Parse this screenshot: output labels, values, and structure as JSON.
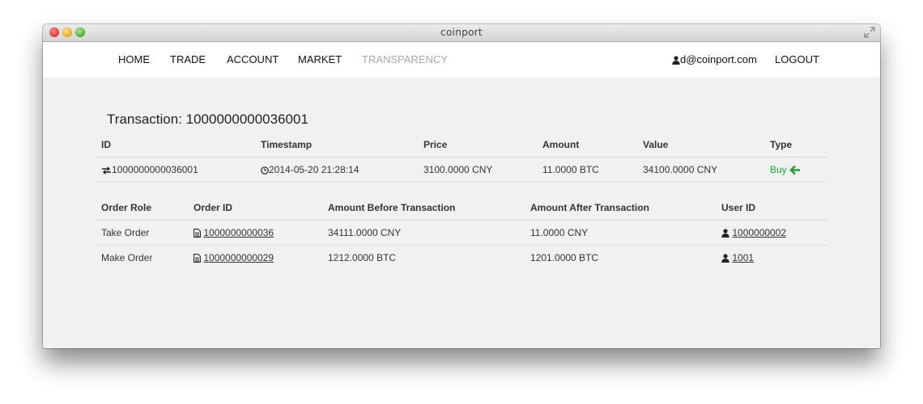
{
  "window": {
    "title": "coinport"
  },
  "nav": {
    "home": "HOME",
    "trade": "TRADE",
    "account": "ACCOUNT",
    "market": "MARKET",
    "transparency": "TRANSPARENCY",
    "user_email": "d@coinport.com",
    "logout": "LOGOUT"
  },
  "page": {
    "title": "Transaction: 1000000000036001"
  },
  "transaction": {
    "headers": {
      "id": "ID",
      "timestamp": "Timestamp",
      "price": "Price",
      "amount": "Amount",
      "value": "Value",
      "type": "Type"
    },
    "row": {
      "id": "1000000000036001",
      "timestamp": "2014-05-20 21:28:14",
      "price": "3100.0000 CNY",
      "amount": "11.0000 BTC",
      "value": "34100.0000 CNY",
      "type": "Buy"
    }
  },
  "orders": {
    "headers": {
      "role": "Order Role",
      "order_id": "Order ID",
      "before": "Amount Before Transaction",
      "after": "Amount After Transaction",
      "user_id": "User ID"
    },
    "rows": [
      {
        "role": "Take Order",
        "order_id": "1000000000036",
        "before": "34111.0000 CNY",
        "after": "11.0000 CNY",
        "user_id": "1000000002"
      },
      {
        "role": "Make Order",
        "order_id": "1000000000029",
        "before": "1212.0000 BTC",
        "after": "1201.0000 BTC",
        "user_id": "1001"
      }
    ]
  },
  "colors": {
    "buy": "#2a9c3c",
    "nav_muted": "#aaaaaa",
    "background": "#f1f1f1"
  }
}
